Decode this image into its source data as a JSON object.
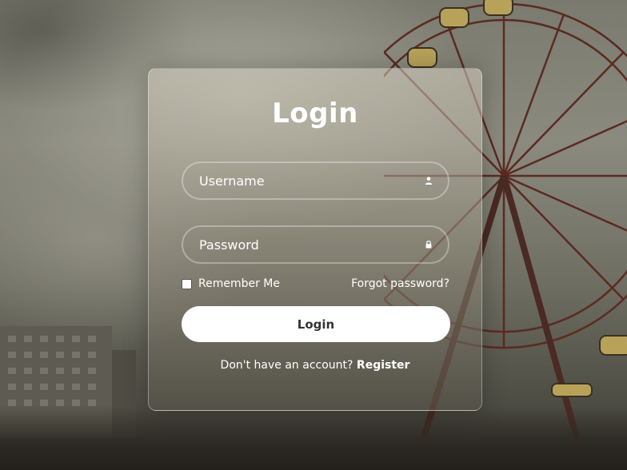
{
  "login_form": {
    "title": "Login",
    "username": {
      "placeholder": "Username",
      "icon": "user-icon"
    },
    "password": {
      "placeholder": "Password",
      "icon": "lock-icon"
    },
    "remember_label": "Remember Me",
    "forgot_label": "Forgot password?",
    "submit_label": "Login",
    "register_prompt": "Don't have an account?",
    "register_label": "Register"
  },
  "colors": {
    "text": "#ffffff",
    "button_bg": "#ffffff",
    "button_text": "#333333"
  }
}
